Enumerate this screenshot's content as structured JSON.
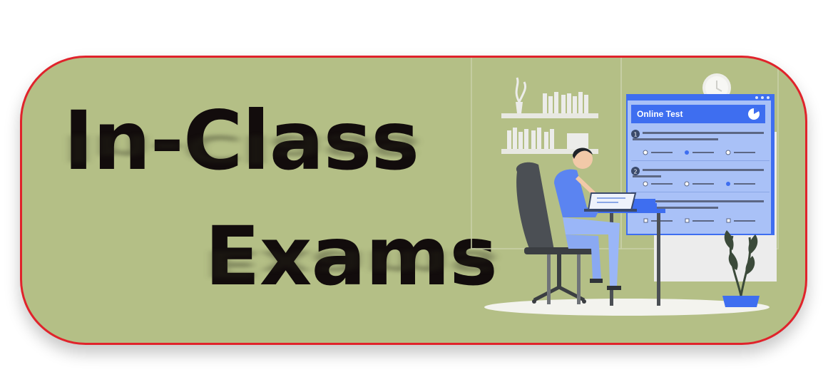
{
  "banner": {
    "title_line1": "In-Class",
    "title_line2": "Exams",
    "border_color": "#e0232b",
    "background_color": "#b4bf86"
  },
  "illustration": {
    "screen_title": "Online Test",
    "question_numbers": [
      "1",
      "2"
    ],
    "icons": [
      "clock-icon",
      "plant-icon",
      "pie-chart-icon",
      "laptop-icon"
    ]
  }
}
